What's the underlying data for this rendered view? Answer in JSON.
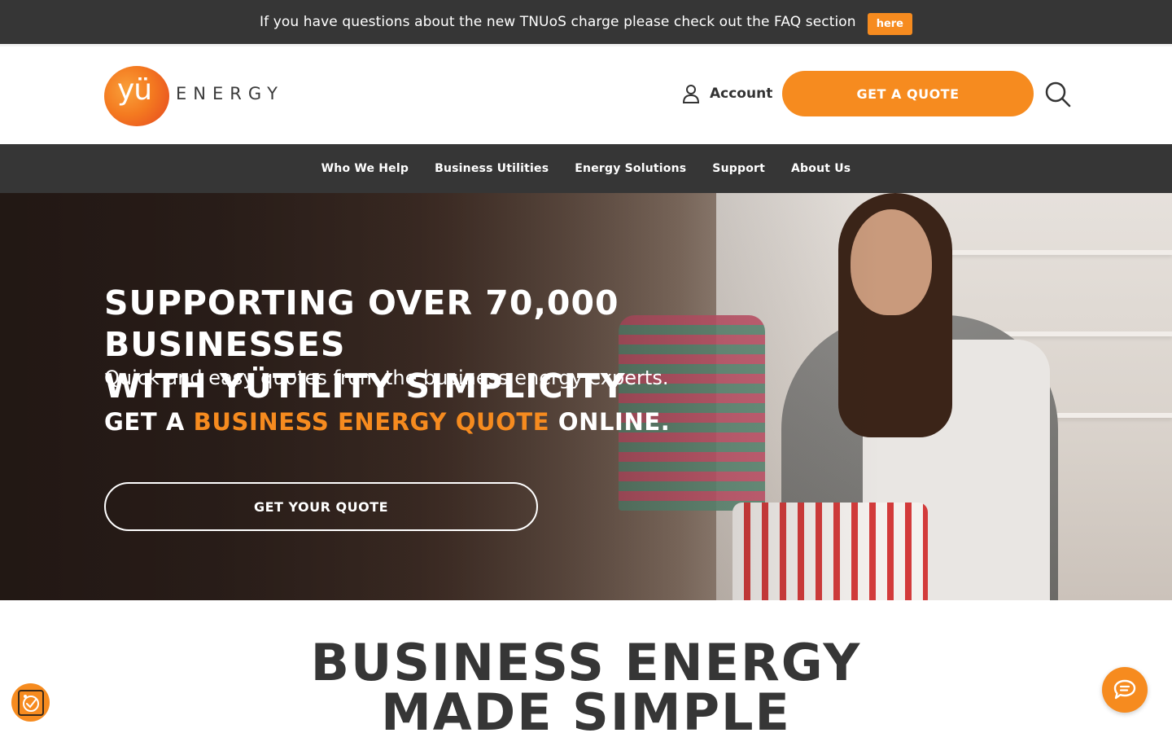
{
  "announcement": {
    "text": "If you have questions about the new TNUoS charge please check out the FAQ section",
    "link_label": "here"
  },
  "header": {
    "logo_mark": "yü",
    "logo_word": "ENERGY",
    "account_label": "Account",
    "quote_button": "GET A QUOTE"
  },
  "nav": {
    "items": [
      {
        "label": "Who We Help"
      },
      {
        "label": "Business Utilities"
      },
      {
        "label": "Energy Solutions"
      },
      {
        "label": "Support"
      },
      {
        "label": "About Us"
      }
    ]
  },
  "hero": {
    "title_line1": "SUPPORTING OVER 70,000 BUSINESSES",
    "title_line2": "WITH YÜTILITY SIMPLICITY",
    "subtitle": "Quick and easy quotes from the business energy experts.",
    "cta_prefix": "GET A ",
    "cta_accent": "BUSINESS ENERGY QUOTE",
    "cta_suffix": " ONLINE.",
    "button": "GET YOUR QUOTE"
  },
  "section": {
    "title_line1": "BUSINESS ENERGY",
    "title_line2": "MADE SIMPLE"
  },
  "icons": {
    "account": "user-icon",
    "search": "search-icon",
    "chat": "chat-icon",
    "cookie": "cookie-settings-icon"
  },
  "colors": {
    "accent": "#f68b1f",
    "dark_bar": "#363636",
    "text": "#333333",
    "white": "#ffffff"
  }
}
